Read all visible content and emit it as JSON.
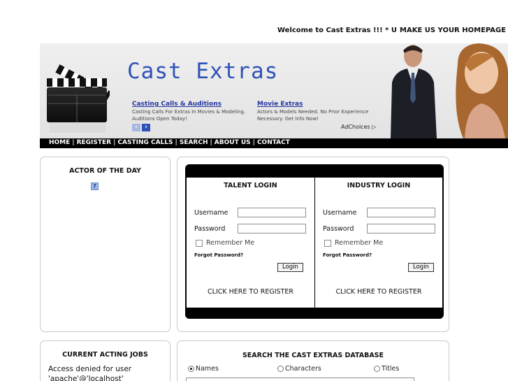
{
  "topbar": {
    "welcome": "Welcome to Cast Extras !!! * U",
    "homepage_link": "MAKE US YOUR HOMEPAGE"
  },
  "banner": {
    "logo": "Cast Extras",
    "ads": [
      {
        "title": "Casting Calls & Auditions",
        "text": "Casting Calls For Extras In Movies & Modeling. Auditions Open Today!"
      },
      {
        "title": "Movie Extras",
        "text": "Actors & Models Needed. No Prior Experience Necessary. Get Info Now!"
      }
    ],
    "adchoices": "AdChoices ▷",
    "arrow_prev": "‹",
    "arrow_next": "›"
  },
  "nav": {
    "items": [
      "HOME",
      "REGISTER",
      "CASTING CALLS",
      "SEARCH",
      "ABOUT US",
      "CONTACT"
    ],
    "separator": "|"
  },
  "actor_of_day": {
    "title": "ACTOR OF THE DAY",
    "placeholder_icon": "?"
  },
  "login": {
    "talent": {
      "title": "TALENT LOGIN",
      "username_label": "Username",
      "password_label": "Password",
      "remember_label": "Remember Me",
      "forgot_label": "Forgot Password?",
      "button_label": "Login",
      "register_label": "CLICK HERE TO REGISTER"
    },
    "industry": {
      "title": "INDUSTRY LOGIN",
      "username_label": "Username",
      "password_label": "Password",
      "remember_label": "Remember Me",
      "forgot_label": "Forgot Password?",
      "button_label": "Login",
      "register_label": "CLICK HERE TO REGISTER"
    }
  },
  "jobs": {
    "title": "CURRENT ACTING JOBS",
    "message_line1": "Access denied for user",
    "message_line2": "'apache'@'localhost'"
  },
  "search": {
    "title": "SEARCH THE CAST EXTRAS DATABASE",
    "options": [
      {
        "label": "Names",
        "selected": true
      },
      {
        "label": "Characters",
        "selected": false
      },
      {
        "label": "Titles",
        "selected": false
      }
    ]
  },
  "colors": {
    "logo_blue": "#2f52b6",
    "ad_link": "#2436a0",
    "nav_bg": "#000000"
  }
}
